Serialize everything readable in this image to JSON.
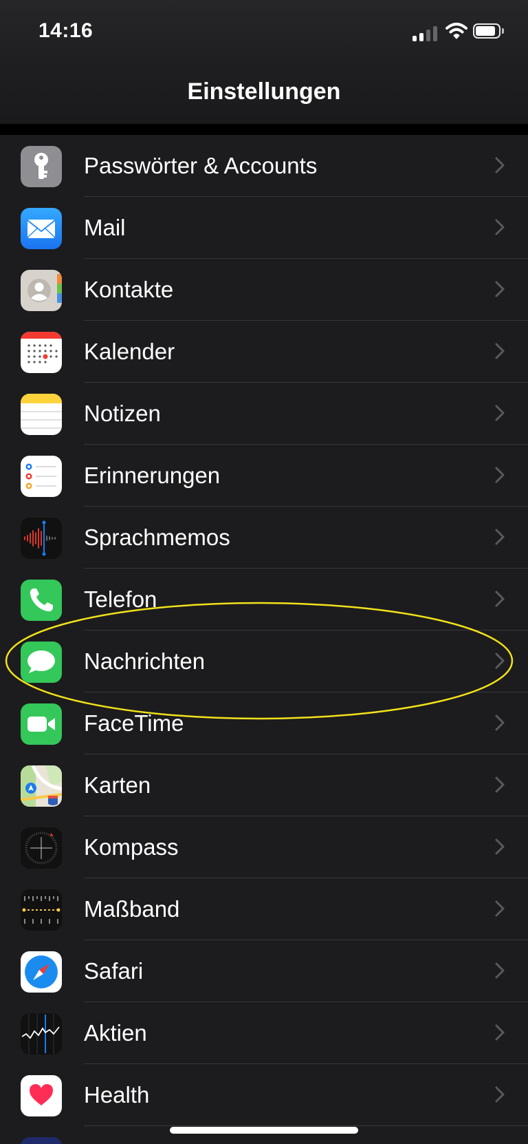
{
  "status_bar": {
    "time": "14:16"
  },
  "nav": {
    "title": "Einstellungen"
  },
  "items": [
    {
      "label": "Passwörter & Accounts",
      "icon": "key-icon"
    },
    {
      "label": "Mail",
      "icon": "mail-icon"
    },
    {
      "label": "Kontakte",
      "icon": "contacts-icon"
    },
    {
      "label": "Kalender",
      "icon": "calendar-icon"
    },
    {
      "label": "Notizen",
      "icon": "notes-icon"
    },
    {
      "label": "Erinnerungen",
      "icon": "reminders-icon"
    },
    {
      "label": "Sprachmemos",
      "icon": "voice-memos-icon"
    },
    {
      "label": "Telefon",
      "icon": "phone-icon"
    },
    {
      "label": "Nachrichten",
      "icon": "messages-icon"
    },
    {
      "label": "FaceTime",
      "icon": "facetime-icon"
    },
    {
      "label": "Karten",
      "icon": "maps-icon"
    },
    {
      "label": "Kompass",
      "icon": "compass-icon"
    },
    {
      "label": "Maßband",
      "icon": "measure-icon"
    },
    {
      "label": "Safari",
      "icon": "safari-icon"
    },
    {
      "label": "Aktien",
      "icon": "stocks-icon"
    },
    {
      "label": "Health",
      "icon": "health-icon"
    }
  ],
  "highlighted_item": "Nachrichten",
  "colors": {
    "background": "#1c1c1e",
    "separator": "#38383a",
    "highlight_ring": "#f2e21a",
    "chevron": "#5a5a5e"
  }
}
